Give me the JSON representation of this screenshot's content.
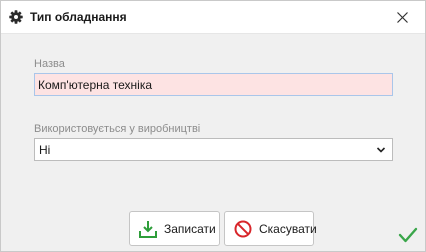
{
  "window": {
    "title": "Тип обладнання",
    "title_icon": "gear-icon",
    "close_icon": "close-icon"
  },
  "form": {
    "name": {
      "label": "Назва",
      "value": "Комп'ютерна техніка"
    },
    "used_in_production": {
      "label": "Використовується у виробництві",
      "selected": "Ні",
      "icon": "chevron-down-icon"
    }
  },
  "buttons": {
    "save": {
      "label": "Записати",
      "icon": "save-download-icon",
      "color": "#2e9e3a"
    },
    "cancel": {
      "label": "Скасувати",
      "icon": "cancel-icon",
      "color": "#d8262b"
    }
  },
  "status": {
    "icon": "check-icon",
    "color": "#3aa64a"
  }
}
